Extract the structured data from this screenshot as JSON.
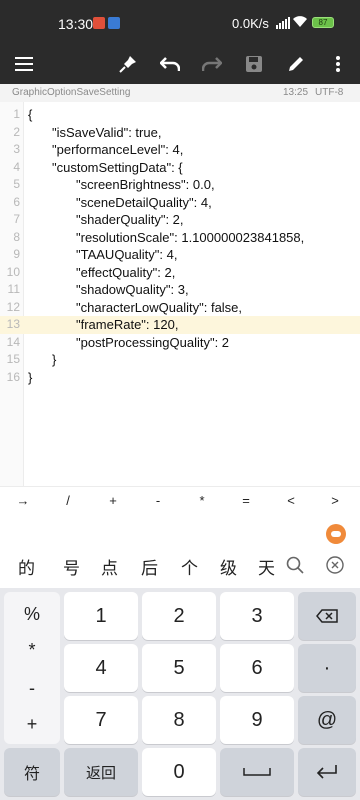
{
  "status_bar": {
    "time": "13:30",
    "network_speed": "0.0K/s",
    "battery_level": "87"
  },
  "toolbar": {
    "icons": [
      "menu-icon",
      "pin-icon",
      "undo-icon",
      "redo-icon",
      "save-icon",
      "edit-icon",
      "more-icon"
    ]
  },
  "file_info": {
    "filename": "GraphicOptionSaveSetting",
    "time": "13:25",
    "encoding": "UTF-8"
  },
  "editor": {
    "highlighted_line": 13,
    "lines": [
      {
        "num": "1",
        "text": "{"
      },
      {
        "num": "2",
        "text": "\"isSaveValid\": true,"
      },
      {
        "num": "3",
        "text": "\"performanceLevel\": 4,"
      },
      {
        "num": "4",
        "text": "\"customSettingData\": {"
      },
      {
        "num": "5",
        "text": "\"screenBrightness\": 0.0,"
      },
      {
        "num": "6",
        "text": "\"sceneDetailQuality\": 4,"
      },
      {
        "num": "7",
        "text": "\"shaderQuality\": 2,"
      },
      {
        "num": "8",
        "text": "\"resolutionScale\": 1.100000023841858,"
      },
      {
        "num": "9",
        "text": "\"TAAUQuality\": 4,"
      },
      {
        "num": "10",
        "text": "\"effectQuality\": 2,"
      },
      {
        "num": "11",
        "text": "\"shadowQuality\": 3,"
      },
      {
        "num": "12",
        "text": "\"characterLowQuality\": false,"
      },
      {
        "num": "13",
        "text": "\"frameRate\": 120,"
      },
      {
        "num": "14",
        "text": "\"postProcessingQuality\": 2"
      },
      {
        "num": "15",
        "text": "}"
      },
      {
        "num": "16",
        "text": "}"
      }
    ]
  },
  "symbol_row": [
    "→",
    "/",
    "+",
    "-",
    "*",
    "=",
    "<",
    ">"
  ],
  "candidates": [
    "的",
    "号",
    "点",
    "后",
    "个",
    "级",
    "天"
  ],
  "keyboard": {
    "left_column": [
      "%",
      "*",
      "-",
      "+"
    ],
    "digits": [
      "1",
      "2",
      "3",
      "4",
      "5",
      "6",
      "7",
      "8",
      "9",
      "0"
    ],
    "dot": "·",
    "at": "@",
    "symbol_key": "符",
    "back_key": "返回"
  },
  "colors": {
    "toolbar_bg": "#2b2b2b",
    "highlight_line": "#fdf6dc",
    "keyboard_bg": "#e7e8ec",
    "accent_orange": "#f08a3a"
  }
}
